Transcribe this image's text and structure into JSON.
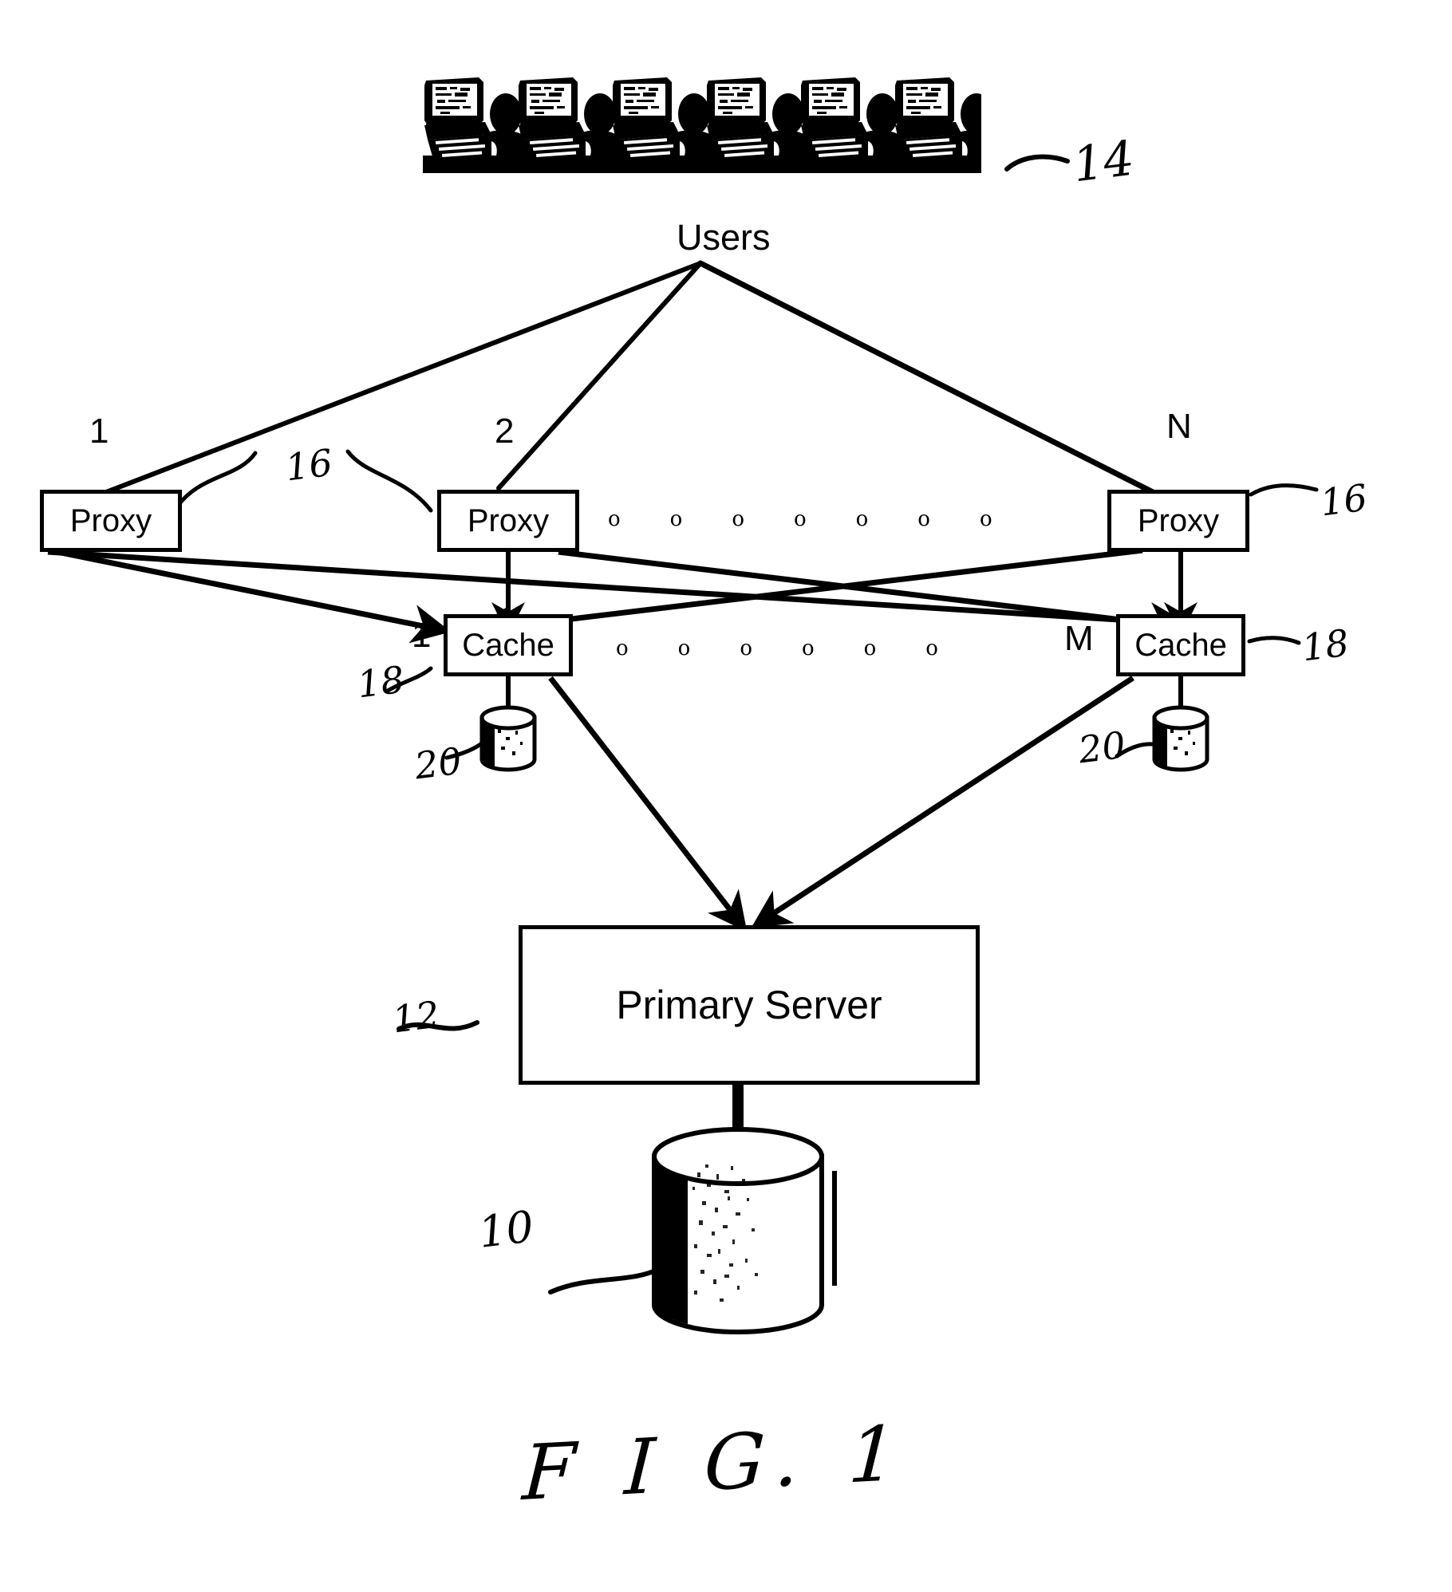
{
  "figure": {
    "caption": "F I G.  1",
    "domain": "patent-figure"
  },
  "nodes": {
    "users": {
      "label": "Users",
      "ref": "14",
      "workstation_count": 6,
      "icon": "users-workstations-clipart"
    },
    "proxies": [
      {
        "index_label": "1",
        "label": "Proxy"
      },
      {
        "index_label": "2",
        "label": "Proxy"
      },
      {
        "index_label": "N",
        "label": "Proxy"
      }
    ],
    "proxy_refs": [
      "16",
      "16"
    ],
    "caches": [
      {
        "index_label": "1",
        "label": "Cache"
      },
      {
        "index_label": "M",
        "label": "Cache"
      }
    ],
    "cache_refs": [
      "18",
      "18"
    ],
    "cache_disk_refs": [
      "20",
      "20"
    ],
    "server": {
      "label": "Primary Server",
      "ref": "12"
    },
    "database": {
      "ref": "10",
      "icon": "database-cylinder-icon"
    }
  },
  "ellipsis": {
    "proxy_row": "o   o   o   o   o   o   o",
    "cache_row": "o   o   o   o   o   o"
  },
  "colors": {
    "ink": "#000000",
    "paper": "#ffffff"
  }
}
